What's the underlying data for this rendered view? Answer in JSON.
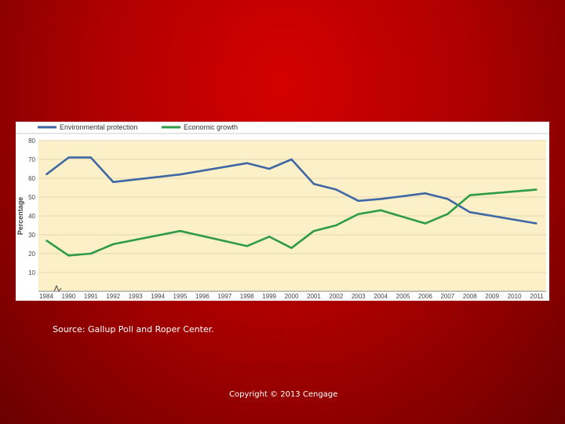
{
  "source": "Source: Gallup Poll and Roper Center.",
  "copyright": "Copyright © 2013 Cengage",
  "colors": {
    "background": "#b00000",
    "plot_area": "#fbf0c8",
    "grid": "#e3d9b4",
    "series_environment": "#3f67a4",
    "series_economy": "#2e9b47"
  },
  "chart_data": {
    "type": "line",
    "title": "",
    "xlabel": "",
    "ylabel": "Percentage",
    "categories": [
      "1984",
      "1990",
      "1991",
      "1992",
      "1993",
      "1994",
      "1995",
      "1996",
      "1997",
      "1998",
      "1999",
      "2000",
      "2001",
      "2002",
      "2003",
      "2004",
      "2005",
      "2006",
      "2007",
      "2008",
      "2009",
      "2010",
      "2011"
    ],
    "y_ticks": [
      "10",
      "20",
      "30",
      "40",
      "50",
      "60",
      "70",
      "80"
    ],
    "ylim": [
      0,
      80
    ],
    "grid": true,
    "legend": "top-left",
    "series": [
      {
        "name": "Environmental protection",
        "color": "#3f67a4",
        "values": [
          62,
          71,
          71,
          58,
          null,
          null,
          62,
          null,
          null,
          68,
          65,
          70,
          57,
          54,
          48,
          49,
          null,
          52,
          49,
          42,
          null,
          null,
          36
        ]
      },
      {
        "name": "Economic growth",
        "color": "#2e9b47",
        "values": [
          27,
          19,
          20,
          25,
          null,
          null,
          32,
          null,
          null,
          24,
          29,
          23,
          32,
          35,
          41,
          43,
          null,
          36,
          41,
          51,
          null,
          null,
          54
        ]
      }
    ]
  }
}
